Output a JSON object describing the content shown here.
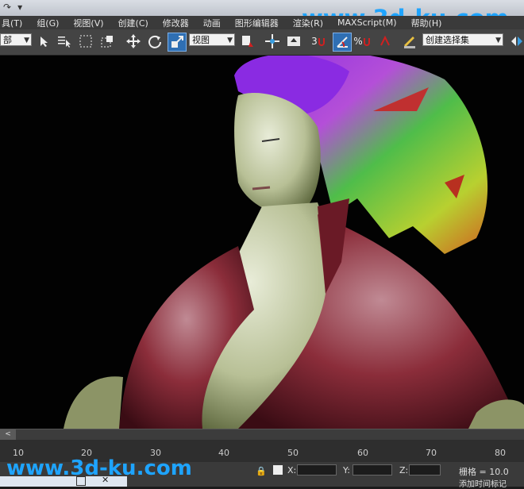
{
  "watermark": {
    "text": "www.3d-ku.com",
    "color": "#1ea4ff"
  },
  "menu": [
    "具(T)",
    "组(G)",
    "视图(V)",
    "创建(C)",
    "修改器",
    "动画",
    "图形编辑器",
    "渲染(R)",
    "MAXScript(M)",
    "帮助(H)"
  ],
  "toolbar": {
    "selection_filter": "部",
    "reference_coord": "视图",
    "named_selection": "创建选择集",
    "snap_label": "3",
    "percent_label": "%"
  },
  "timeslider": {
    "label": "<"
  },
  "timeline": {
    "labels": [
      "10",
      "20",
      "30",
      "40",
      "50",
      "60",
      "70",
      "80"
    ]
  },
  "status": {
    "x_label": "X:",
    "y_label": "Y:",
    "z_label": "Z:",
    "grid": "栅格 = 10.0",
    "add_time_tag": "添加时间标记"
  },
  "colors": {
    "hair": "#8a2be2",
    "shirt": "#8b2d3a",
    "skin": "#c7cfa6"
  }
}
